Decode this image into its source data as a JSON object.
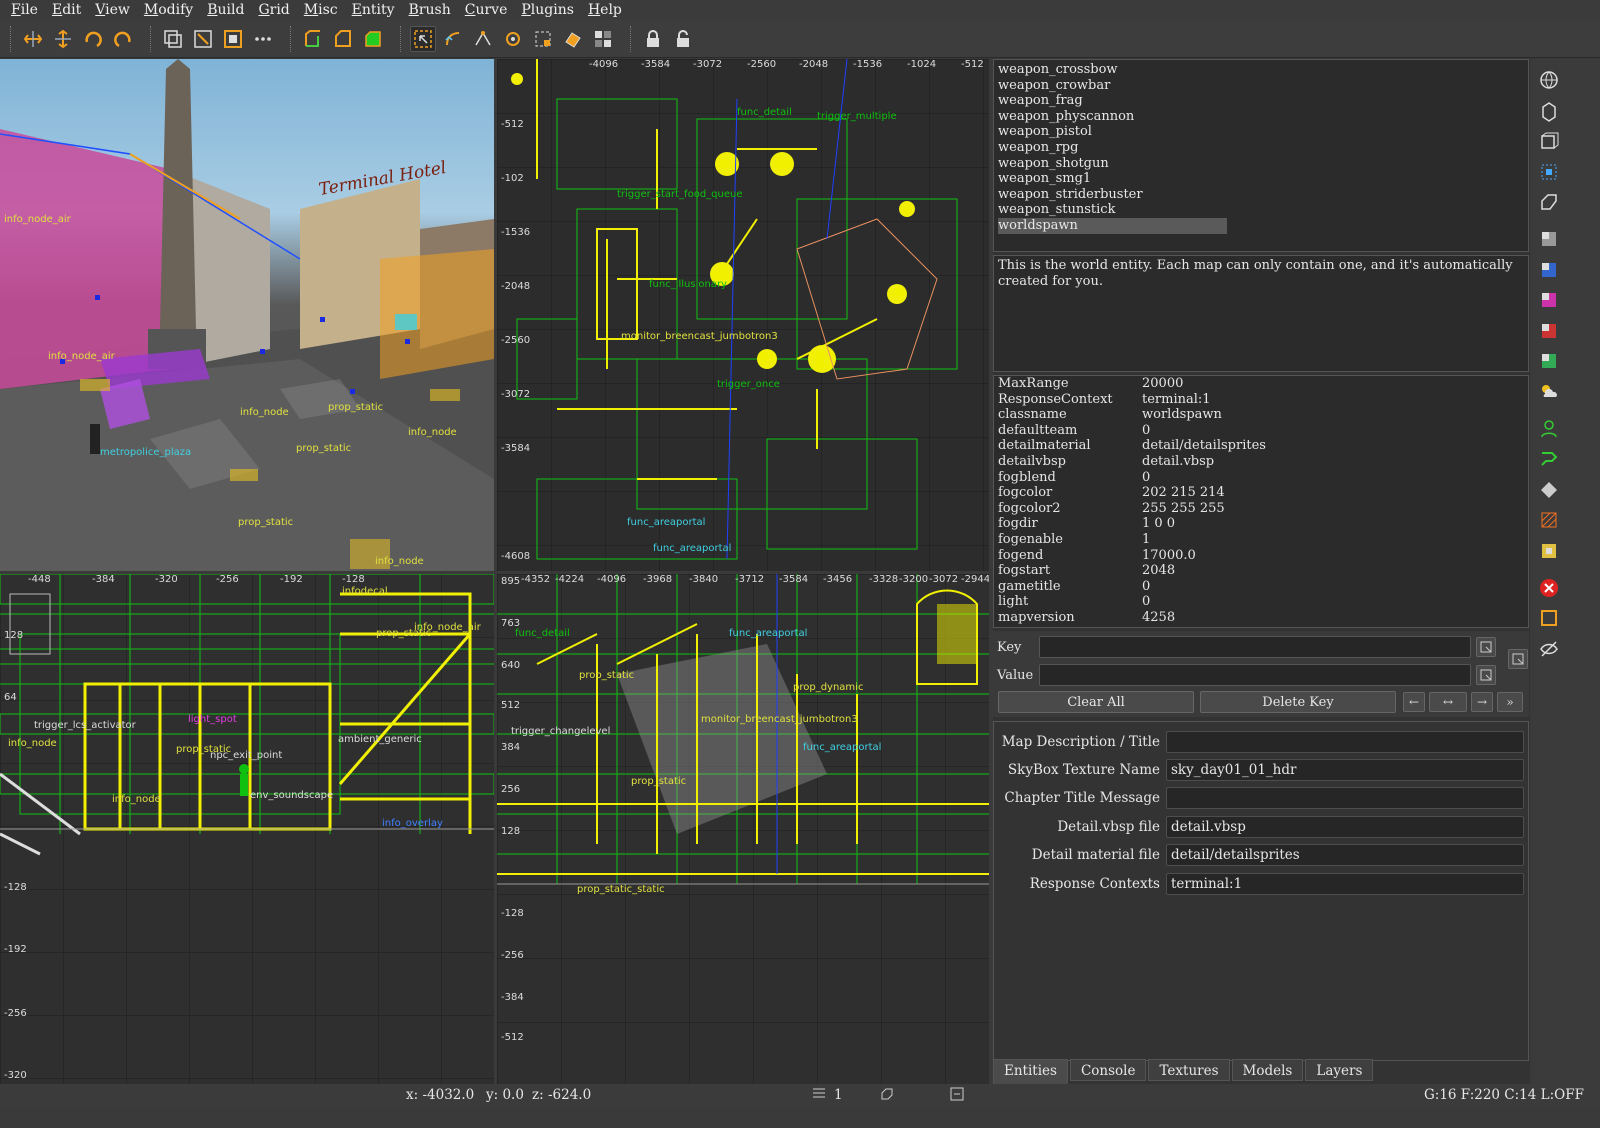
{
  "menubar": {
    "items": [
      "File",
      "Edit",
      "View",
      "Modify",
      "Build",
      "Grid",
      "Misc",
      "Entity",
      "Brush",
      "Curve",
      "Plugins",
      "Help"
    ]
  },
  "toolbar": {
    "groups": [
      [
        "flip-horizontal-icon",
        "flip-vertical-icon",
        "rotate-x-icon",
        "rotate-y-icon"
      ],
      [
        "clone-icon",
        "select-inside-icon",
        "select-complete-icon",
        "more-icon"
      ],
      [
        "clipper-icon",
        "csg-subtract-icon",
        "csg-merge-icon"
      ],
      [
        "select-mode-icon",
        "rotate-mode-icon",
        "drag-vertex-icon",
        "drag-edge-icon",
        "scale-icon",
        "texture-lock-icon",
        "texture-tool-icon"
      ],
      [
        "lock-icon",
        "unlock-icon"
      ]
    ]
  },
  "viewports": {
    "top": {
      "x_ticks": [
        "-4096",
        "-3584",
        "-3072",
        "-2560",
        "-2048",
        "-1536",
        "-1024",
        "-512"
      ],
      "y_ticks": [
        "-512",
        "-102",
        "-1536",
        "-2048",
        "-2560",
        "-3072",
        "-3584",
        "-4608"
      ],
      "labels": [
        "func_detail",
        "trigger_multiple",
        "func_illusionary",
        "trigger_once",
        "func_areaportal",
        "trigger_start_food_queue",
        "func_areaportal",
        "monitor_breencast_jumbotron3"
      ]
    },
    "side": {
      "x_ticks": [
        "-448",
        "-384",
        "-320",
        "-256",
        "-192",
        "-128"
      ],
      "y_ticks": [
        "128",
        "64",
        "-128",
        "-192",
        "-256",
        "-320"
      ],
      "labels": [
        "infodecal",
        "prop_static",
        "info_node_air",
        "trigger_lcs_activator",
        "info_node",
        "prop_static",
        "light_spot",
        "npc_exit_point",
        "info_node",
        "ambient_generic",
        "env_soundscape",
        "info_overlay"
      ]
    },
    "front": {
      "x_ticks": [
        "-4352",
        "-4224",
        "-4096",
        "-3968",
        "-3840",
        "-3712",
        "-3584",
        "-3456",
        "-3328",
        "-3200",
        "-3072",
        "-2944"
      ],
      "y_ticks": [
        "895",
        "763",
        "640",
        "512",
        "384",
        "256",
        "128",
        "-128",
        "-256",
        "-384",
        "-512"
      ],
      "labels": [
        "func_detail",
        "func_areaportal",
        "prop_dynamic",
        "prop_static",
        "monitor_breencast_jumbotron3",
        "trigger_changelevel",
        "func_areaportal",
        "prop_static",
        "prop_static_static"
      ]
    },
    "cam": {
      "labels": [
        "info_node_air",
        "info_node_air",
        "info_node",
        "prop_static",
        "info_node",
        "metropolice_plaza",
        "prop_static",
        "prop_static",
        "info_node",
        "Terminal Hotel"
      ]
    }
  },
  "entity_list": {
    "items": [
      "weapon_crossbow",
      "weapon_crowbar",
      "weapon_frag",
      "weapon_physcannon",
      "weapon_pistol",
      "weapon_rpg",
      "weapon_shotgun",
      "weapon_smg1",
      "weapon_striderbuster",
      "weapon_stunstick",
      "worldspawn"
    ],
    "selected_index": 10
  },
  "entity_description": "This is the world entity. Each map can only contain one, and it's automatically created for you.",
  "keyvalues": [
    {
      "key": "MaxRange",
      "value": "20000"
    },
    {
      "key": "ResponseContext",
      "value": "terminal:1"
    },
    {
      "key": "classname",
      "value": "worldspawn"
    },
    {
      "key": "defaultteam",
      "value": "0"
    },
    {
      "key": "detailmaterial",
      "value": "detail/detailsprites"
    },
    {
      "key": "detailvbsp",
      "value": "detail.vbsp"
    },
    {
      "key": "fogblend",
      "value": "0"
    },
    {
      "key": "fogcolor",
      "value": "202 215 214"
    },
    {
      "key": "fogcolor2",
      "value": "255 255 255"
    },
    {
      "key": "fogdir",
      "value": "1 0 0"
    },
    {
      "key": "fogenable",
      "value": "1"
    },
    {
      "key": "fogend",
      "value": "17000.0"
    },
    {
      "key": "fogstart",
      "value": "2048"
    },
    {
      "key": "gametitle",
      "value": "0"
    },
    {
      "key": "light",
      "value": "0"
    },
    {
      "key": "mapversion",
      "value": "4258"
    }
  ],
  "kv_editor": {
    "key_label": "Key",
    "value_label": "Value",
    "key_value": "",
    "value_value": "",
    "clear_all_label": "Clear All",
    "delete_key_label": "Delete Key"
  },
  "properties_form": [
    {
      "label": "Map Description / Title",
      "value": ""
    },
    {
      "label": "SkyBox Texture Name",
      "value": "sky_day01_01_hdr"
    },
    {
      "label": "Chapter Title Message",
      "value": ""
    },
    {
      "label": "Detail.vbsp file",
      "value": "detail.vbsp"
    },
    {
      "label": "Detail material file",
      "value": "detail/detailsprites"
    },
    {
      "label": "Response Contexts",
      "value": "terminal:1"
    }
  ],
  "tabs": [
    "Entities",
    "Console",
    "Textures",
    "Models",
    "Layers"
  ],
  "active_tab": "Entities",
  "statusbar": {
    "coords_x": "x:  -4032.0",
    "coords_y": "y:     0.0",
    "coords_z": "z:  -624.0",
    "brush_count": "1",
    "grid_info": "G:16  F:220  C:14  L:OFF"
  },
  "colors": {
    "panel_bg": "#333333",
    "input_bg": "#262626",
    "brush_yellow": "#f0f000",
    "brush_green": "#10c010",
    "entity_label_cyan": "#40d0e0",
    "entity_label_yellow": "#e0e040",
    "selection_orange": "#ff9020"
  }
}
